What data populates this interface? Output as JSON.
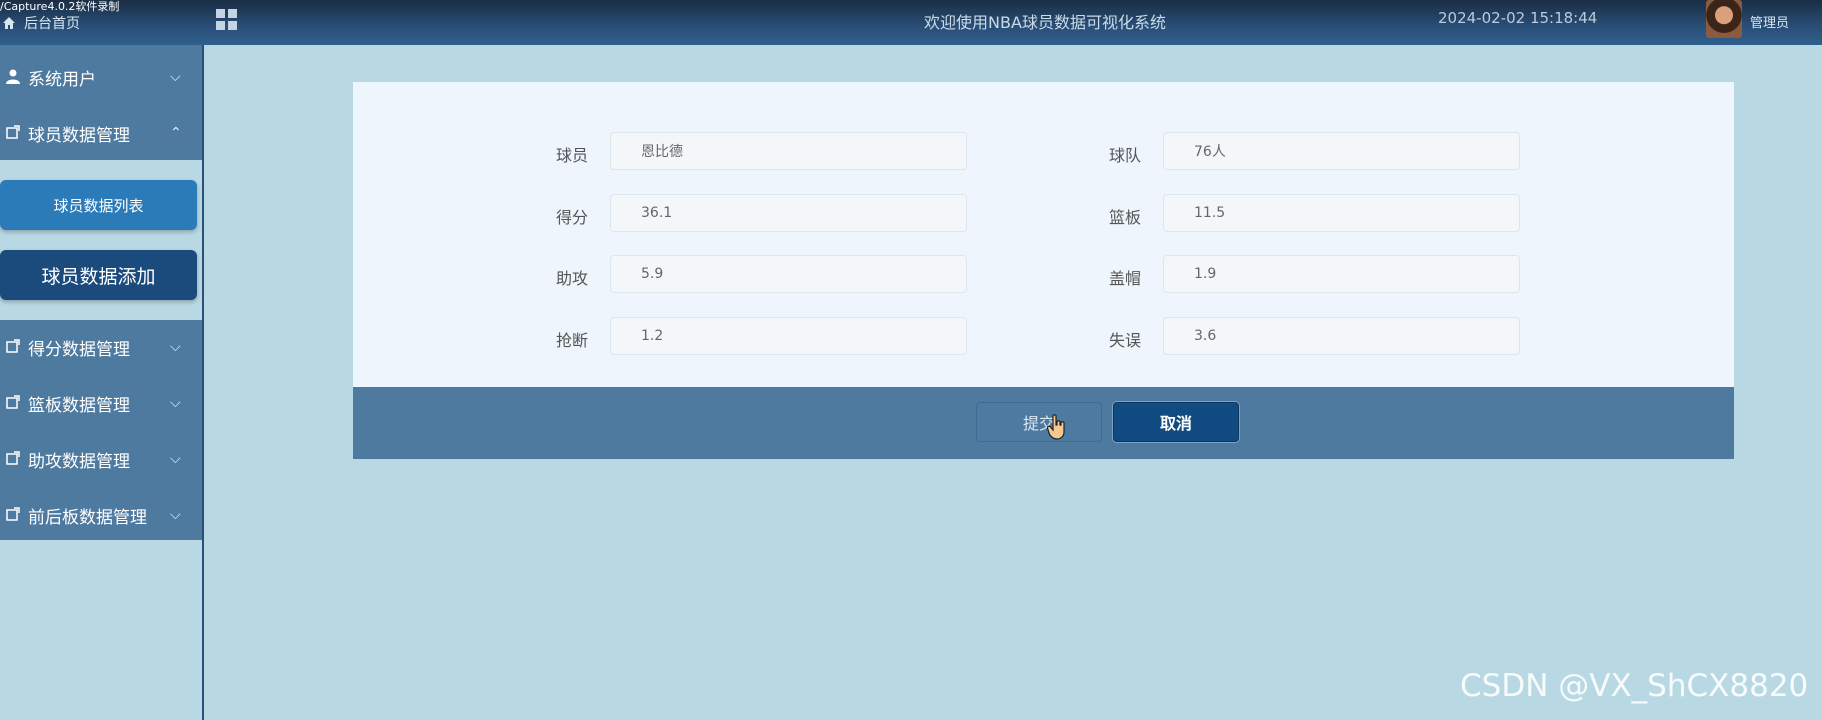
{
  "recorder_label": "/Capture4.0.2软件录制",
  "header": {
    "home_label": "后台首页",
    "title": "欢迎使用NBA球员数据可视化系统",
    "datetime": "2024-02-02 15:18:44",
    "user": "管理员"
  },
  "sidebar": {
    "items": [
      {
        "label": "系统用户",
        "icon": "user-icon",
        "expanded": false
      },
      {
        "label": "球员数据管理",
        "icon": "edit-icon",
        "expanded": true
      },
      {
        "label": "得分数据管理",
        "icon": "edit-icon",
        "expanded": false
      },
      {
        "label": "篮板数据管理",
        "icon": "edit-icon",
        "expanded": false
      },
      {
        "label": "助攻数据管理",
        "icon": "edit-icon",
        "expanded": false
      },
      {
        "label": "前后板数据管理",
        "icon": "edit-icon",
        "expanded": false
      }
    ],
    "submenu": {
      "list_label": "球员数据列表",
      "add_label": "球员数据添加"
    }
  },
  "form": {
    "fields": [
      {
        "label": "球员",
        "value": "恩比德"
      },
      {
        "label": "球队",
        "value": "76人"
      },
      {
        "label": "得分",
        "value": "36.1"
      },
      {
        "label": "篮板",
        "value": "11.5"
      },
      {
        "label": "助攻",
        "value": "5.9"
      },
      {
        "label": "盖帽",
        "value": "1.9"
      },
      {
        "label": "抢断",
        "value": "1.2"
      },
      {
        "label": "失误",
        "value": "3.6"
      }
    ],
    "submit_label": "提交",
    "cancel_label": "取消"
  },
  "watermark": "CSDN @VX_ShCX8820",
  "colors": {
    "header": "#2a4f78",
    "sidebar_menu": "#4e7aa0",
    "page_bg": "#b8d8e3",
    "active_sub": "#1b4a7d",
    "cancel_button": "#124a82"
  }
}
